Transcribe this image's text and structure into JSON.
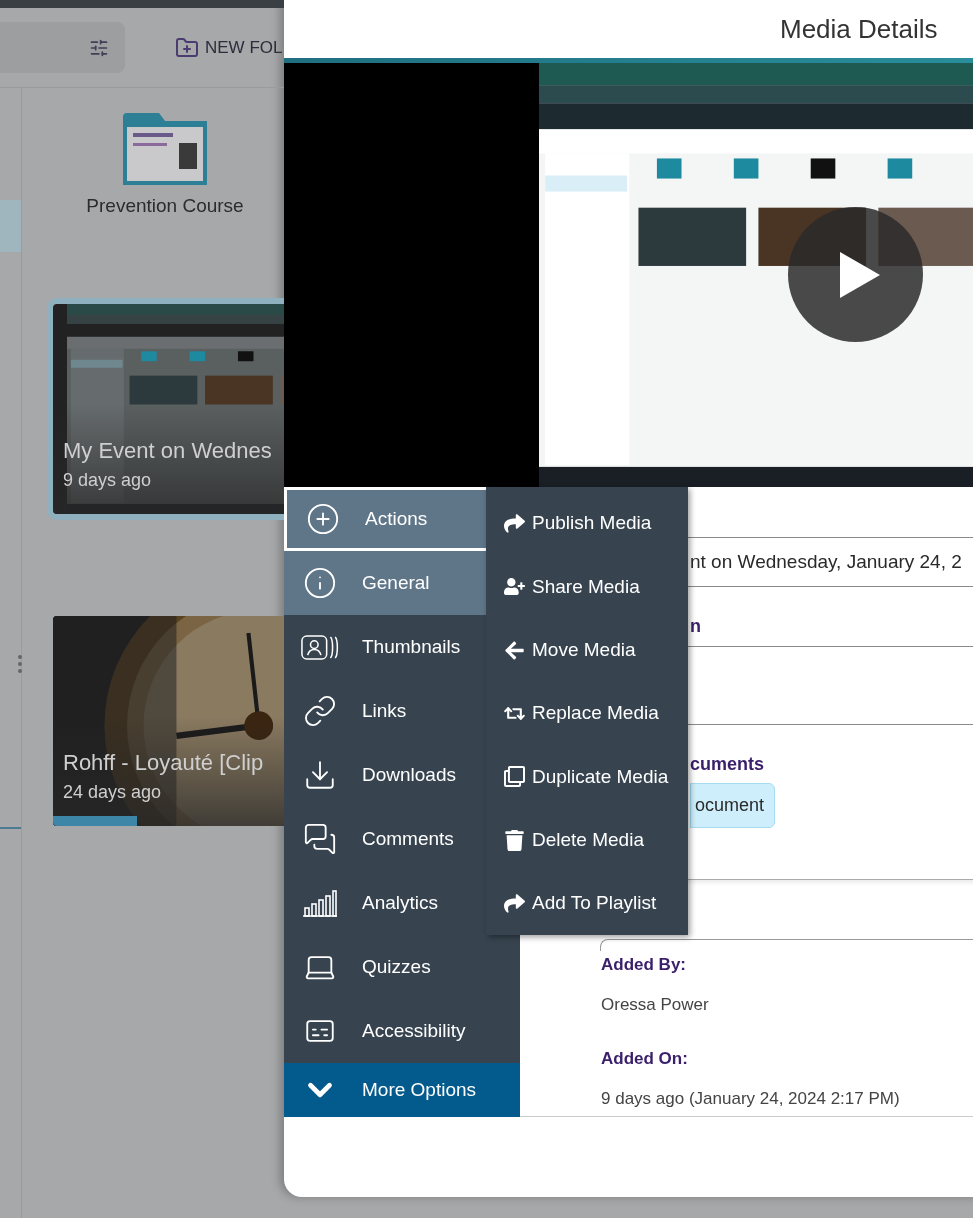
{
  "library": {
    "toolbar_button": "NEW FOL",
    "sidebar": {
      "items": [
        {
          "selected": true
        }
      ]
    },
    "folder": {
      "name": "Prevention Course"
    },
    "cards": [
      {
        "title": "My Event on Wednes",
        "meta": "9 days ago",
        "selected": true,
        "kind": "screen"
      },
      {
        "title": "Rohff - Loyauté [Clip",
        "meta": "24 days ago",
        "selected": false,
        "kind": "clock",
        "level": 0.29
      }
    ]
  },
  "panel": {
    "title": "Media Details",
    "nav": [
      {
        "label": "Actions",
        "selected": true,
        "expanded": true
      },
      {
        "label": "General",
        "selected": true,
        "expanded": false
      },
      {
        "label": "Thumbnails",
        "selected": false,
        "expanded": false
      },
      {
        "label": "Links",
        "selected": false,
        "expanded": false
      },
      {
        "label": "Downloads",
        "selected": false,
        "expanded": false
      },
      {
        "label": "Comments",
        "selected": false,
        "expanded": false
      },
      {
        "label": "Analytics",
        "selected": false,
        "expanded": false
      },
      {
        "label": "Quizzes",
        "selected": false,
        "expanded": false
      },
      {
        "label": "Accessibility",
        "selected": false,
        "expanded": false
      }
    ],
    "more_options": {
      "label": "More Options"
    },
    "actions_menu": [
      "Publish Media",
      "Share Media",
      "Move Media",
      "Replace Media",
      "Duplicate Media",
      "Delete Media",
      "Add To Playlist"
    ],
    "details": {
      "title_value": "nt on Wednesday, January 24, 2",
      "label_1": "n",
      "documents_label": "cuments",
      "document_chip": "ocument",
      "added_by_label": "Added By:",
      "added_by": "Oressa Power",
      "added_on_label": "Added On:",
      "added_on": "9 days ago (January 24, 2024 2:17 PM)"
    }
  }
}
